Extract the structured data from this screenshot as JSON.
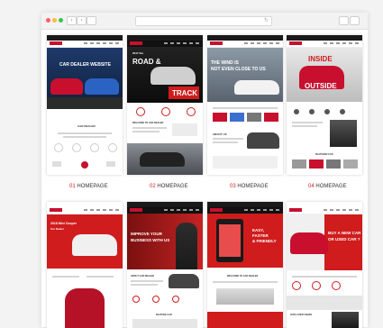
{
  "browser": {
    "dot_colors": [
      "#fc605c",
      "#fdbc40",
      "#34c84a"
    ]
  },
  "captions": [
    {
      "num": "01",
      "label": "HOMEPAGE"
    },
    {
      "num": "02",
      "label": "HOMEPAGE"
    },
    {
      "num": "03",
      "label": "HOMEPAGE"
    },
    {
      "num": "04",
      "label": "HOMEPAGE"
    }
  ],
  "thumbs": {
    "t1": {
      "hero_title": "CAR DEALER WEBSITE",
      "section_title": "CAR DEALER"
    },
    "t2": {
      "line1": "2017 the",
      "line2": "ROAD &",
      "line3": "TRACK",
      "section_title": "WELCOME TO CAR DEALER"
    },
    "t3": {
      "line1": "THE WIND IS",
      "line2": "NOT EVEN CLOSE TO US",
      "section_title": "ABOUT US"
    },
    "t4": {
      "line1": "INSIDE",
      "line2": "OUTSIDE",
      "section_title": "FEATURED CAR"
    },
    "t5": {
      "line1": "2018 Mini Cooper",
      "line2": "Car Dealer"
    },
    "t6": {
      "line1": "IMPROVE YOUR",
      "line2": "BUSINESS WITH US",
      "section_title": "ABOUT CAR DEALER",
      "footer_title": "FEATURE CAR"
    },
    "t7": {
      "line1": "EASY,",
      "line2": "FASTER",
      "line3": "& FRIENDLY",
      "section_title": "WELCOME TO CAR DEALER"
    },
    "t8": {
      "line1": "BUY A NEW CAR",
      "line2": "OR USED CAR ?",
      "section_title": "OUR LATEST NEWS"
    }
  },
  "colors": {
    "accent": "#d01c1c",
    "dark": "#1a1a1a"
  }
}
